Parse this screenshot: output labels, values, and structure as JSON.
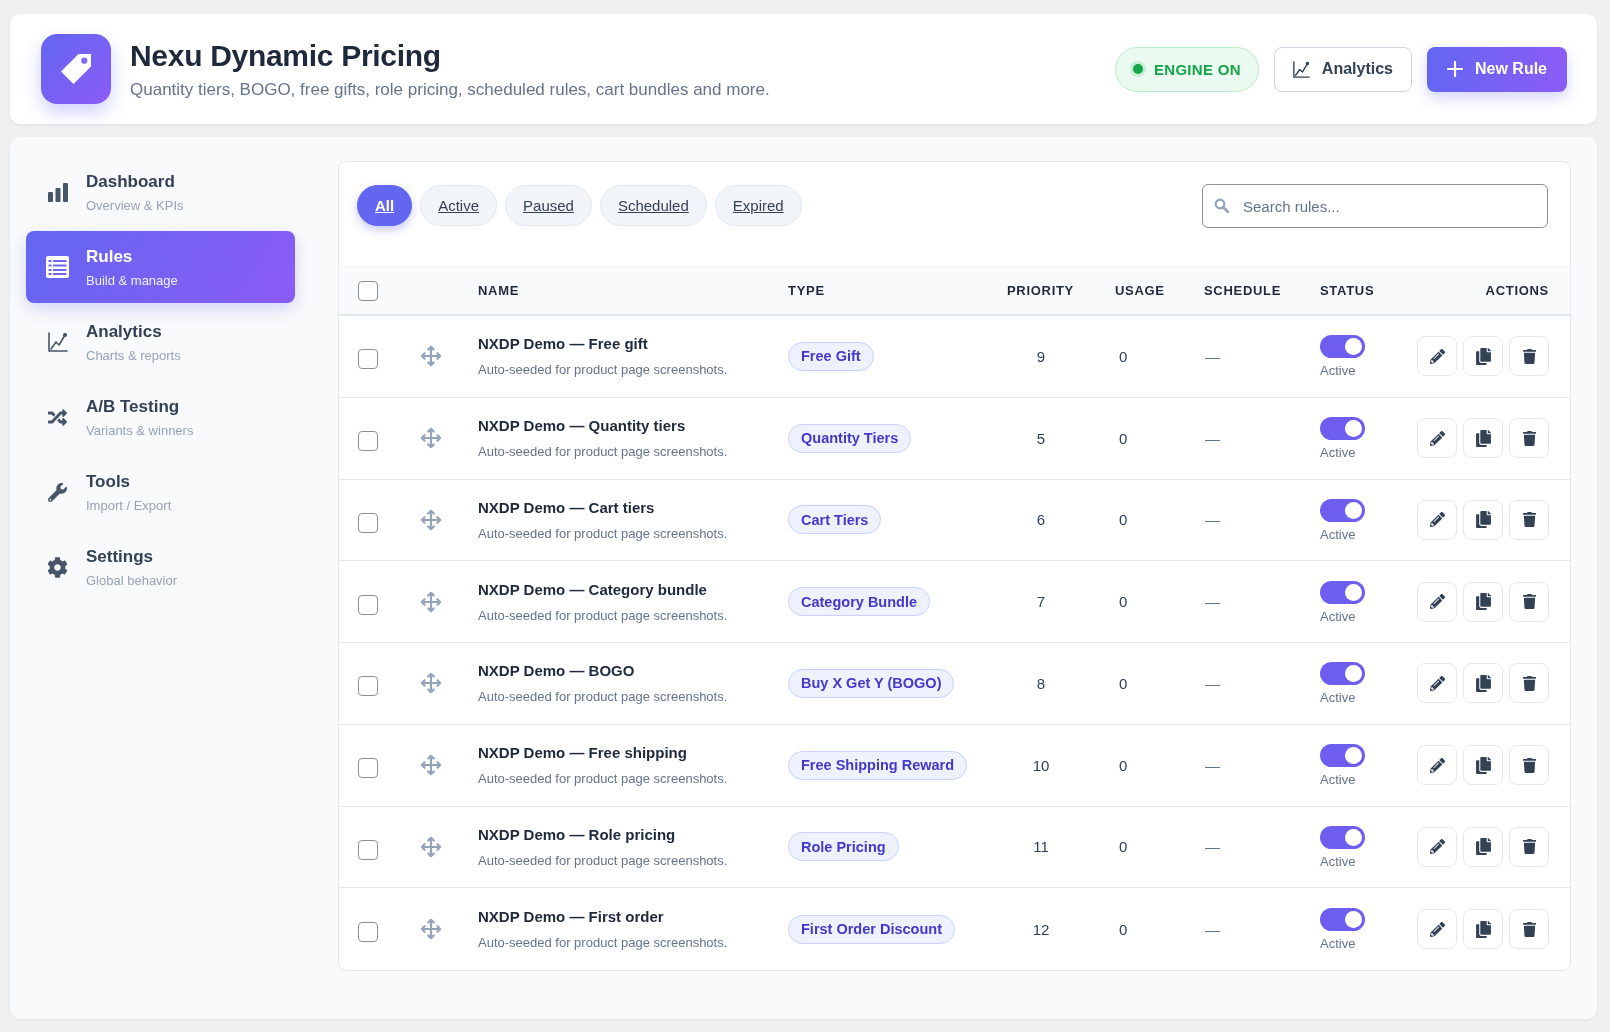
{
  "header": {
    "title": "Nexu Dynamic Pricing",
    "subtitle": "Quantity tiers, BOGO, free gifts, role pricing, scheduled rules, cart bundles and more.",
    "engine": {
      "label": "ENGINE ON",
      "on": true
    },
    "buttons": [
      {
        "label": "Analytics",
        "kind": "secondary"
      },
      {
        "label": "New Rule",
        "kind": "primary"
      }
    ]
  },
  "sidebar": {
    "items": [
      {
        "label": "Dashboard",
        "sublabel": "Overview & KPIs",
        "selected": false
      },
      {
        "label": "Rules",
        "sublabel": "Build & manage",
        "selected": true
      },
      {
        "label": "Analytics",
        "sublabel": "Charts & reports",
        "selected": false
      },
      {
        "label": "A/B Testing",
        "sublabel": "Variants & winners",
        "selected": false
      },
      {
        "label": "Tools",
        "sublabel": "Import / Export",
        "selected": false
      },
      {
        "label": "Settings",
        "sublabel": "Global behavior",
        "selected": false
      }
    ]
  },
  "filters": [
    {
      "label": "All",
      "selected": true
    },
    {
      "label": "Active",
      "selected": false
    },
    {
      "label": "Paused",
      "selected": false
    },
    {
      "label": "Scheduled",
      "selected": false
    },
    {
      "label": "Expired",
      "selected": false
    }
  ],
  "search": {
    "placeholder": "Search rules..."
  },
  "table": {
    "select_all": {
      "checked": false
    },
    "columns": [
      "NAME",
      "TYPE",
      "PRIORITY",
      "USAGE",
      "SCHEDULE",
      "STATUS",
      "ACTIONS"
    ],
    "rows": [
      {
        "checked": false,
        "name": "NXDP Demo — Free gift",
        "description": "Auto-seeded for product page screenshots.",
        "type": "Free Gift",
        "priority": "9",
        "usage": "0",
        "schedule": "—",
        "enabled": true,
        "status": "Active"
      },
      {
        "checked": false,
        "name": "NXDP Demo — Quantity tiers",
        "description": "Auto-seeded for product page screenshots.",
        "type": "Quantity Tiers",
        "priority": "5",
        "usage": "0",
        "schedule": "—",
        "enabled": true,
        "status": "Active"
      },
      {
        "checked": false,
        "name": "NXDP Demo — Cart tiers",
        "description": "Auto-seeded for product page screenshots.",
        "type": "Cart Tiers",
        "priority": "6",
        "usage": "0",
        "schedule": "—",
        "enabled": true,
        "status": "Active"
      },
      {
        "checked": false,
        "name": "NXDP Demo — Category bundle",
        "description": "Auto-seeded for product page screenshots.",
        "type": "Category Bundle",
        "priority": "7",
        "usage": "0",
        "schedule": "—",
        "enabled": true,
        "status": "Active"
      },
      {
        "checked": false,
        "name": "NXDP Demo — BOGO",
        "description": "Auto-seeded for product page screenshots.",
        "type": "Buy X Get Y (BOGO)",
        "priority": "8",
        "usage": "0",
        "schedule": "—",
        "enabled": true,
        "status": "Active"
      },
      {
        "checked": false,
        "name": "NXDP Demo — Free shipping",
        "description": "Auto-seeded for product page screenshots.",
        "type": "Free Shipping Reward",
        "priority": "10",
        "usage": "0",
        "schedule": "—",
        "enabled": true,
        "status": "Active"
      },
      {
        "checked": false,
        "name": "NXDP Demo — Role pricing",
        "description": "Auto-seeded for product page screenshots.",
        "type": "Role Pricing",
        "priority": "11",
        "usage": "0",
        "schedule": "—",
        "enabled": true,
        "status": "Active"
      },
      {
        "checked": false,
        "name": "NXDP Demo — First order",
        "description": "Auto-seeded for product page screenshots.",
        "type": "First Order Discount",
        "priority": "12",
        "usage": "0",
        "schedule": "—",
        "enabled": true,
        "status": "Active"
      }
    ]
  }
}
